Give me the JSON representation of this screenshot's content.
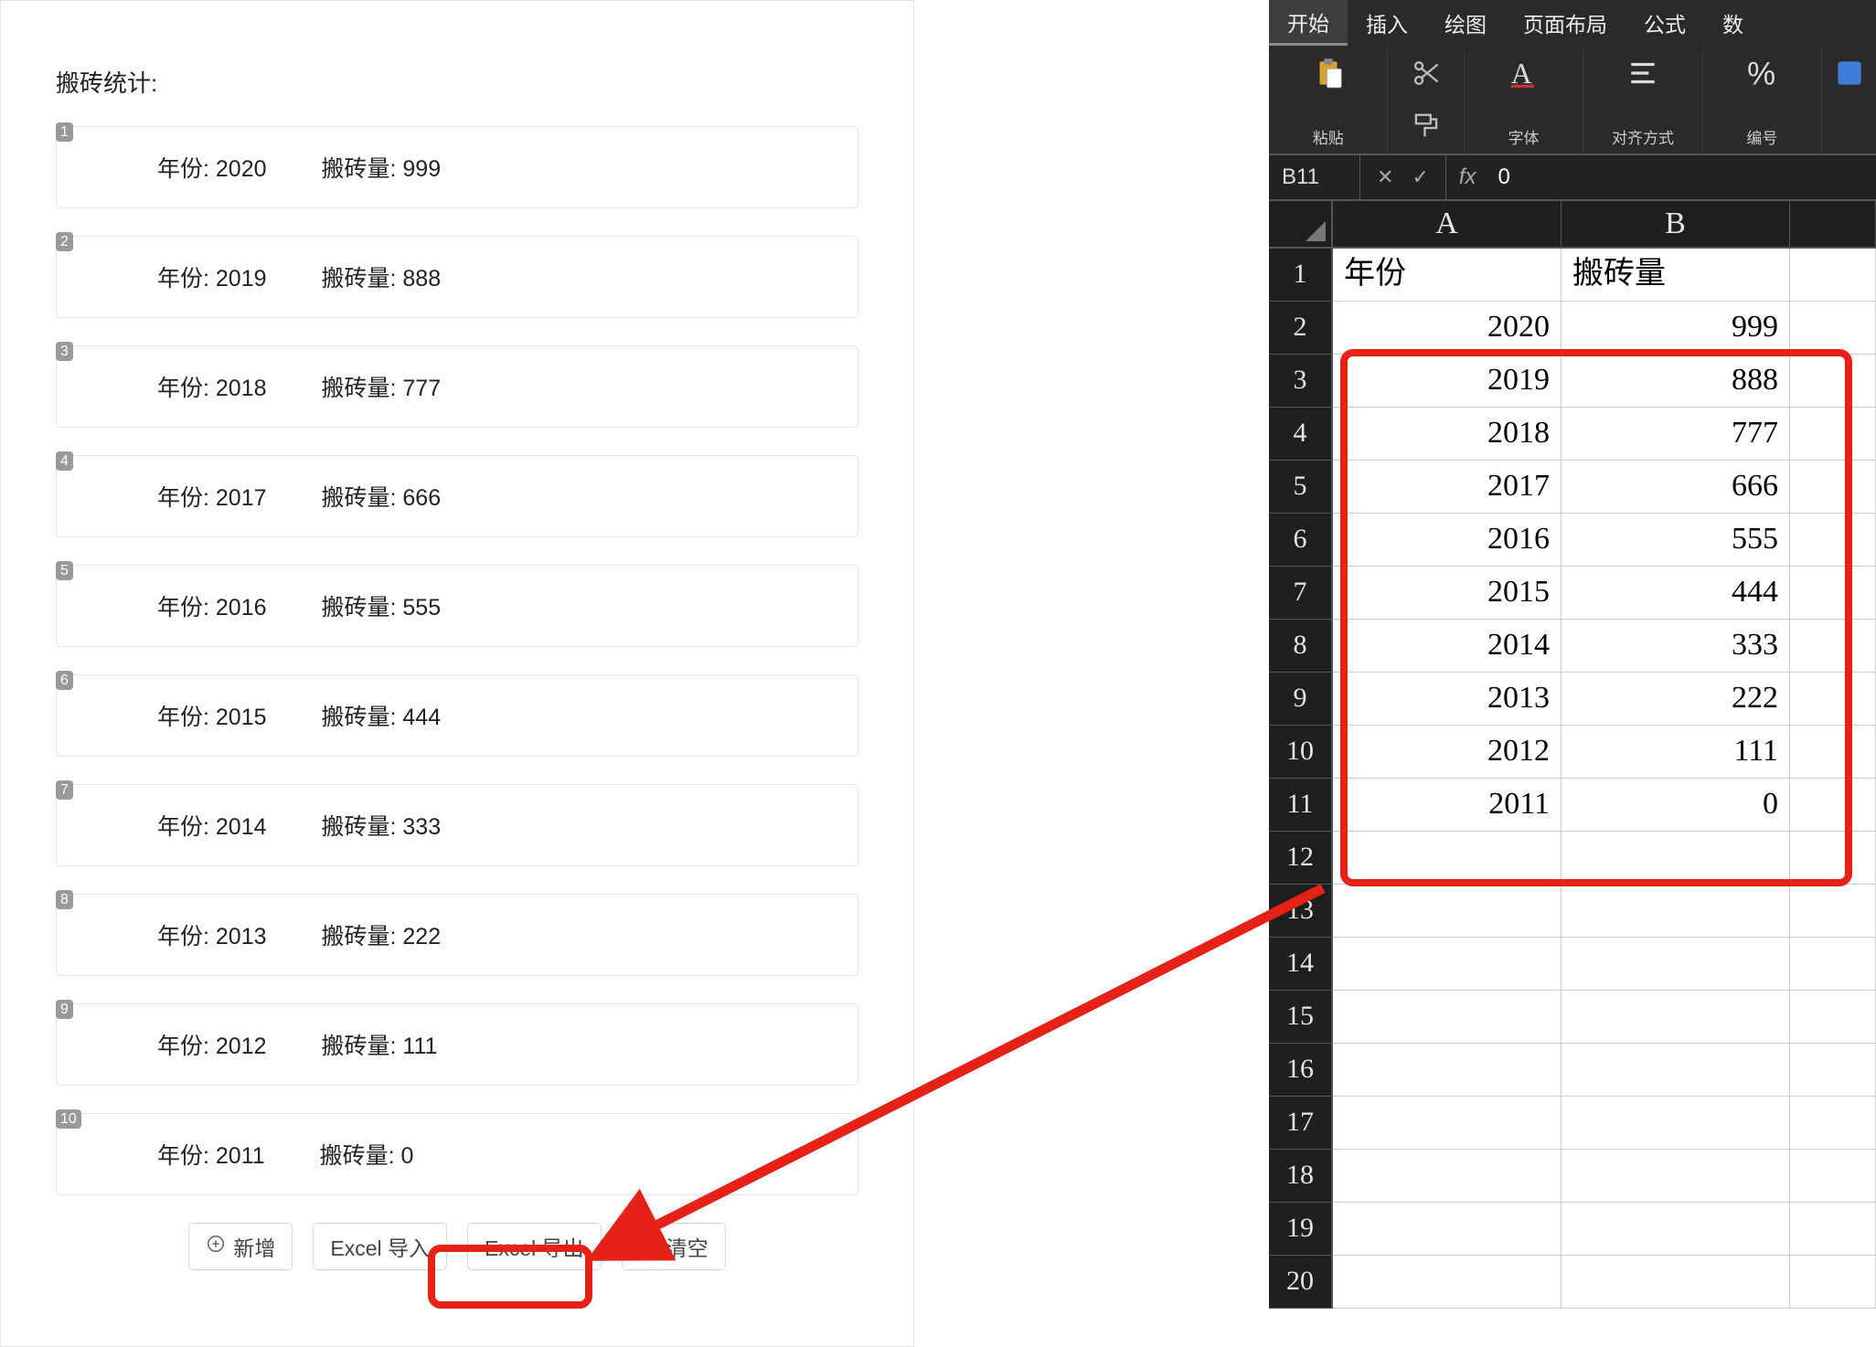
{
  "left": {
    "title": "搬砖统计:",
    "year_label": "年份",
    "amount_label": "搬砖量",
    "rows": [
      {
        "idx": "1",
        "year": "2020",
        "amount": "999"
      },
      {
        "idx": "2",
        "year": "2019",
        "amount": "888"
      },
      {
        "idx": "3",
        "year": "2018",
        "amount": "777"
      },
      {
        "idx": "4",
        "year": "2017",
        "amount": "666"
      },
      {
        "idx": "5",
        "year": "2016",
        "amount": "555"
      },
      {
        "idx": "6",
        "year": "2015",
        "amount": "444"
      },
      {
        "idx": "7",
        "year": "2014",
        "amount": "333"
      },
      {
        "idx": "8",
        "year": "2013",
        "amount": "222"
      },
      {
        "idx": "9",
        "year": "2012",
        "amount": "111"
      },
      {
        "idx": "10",
        "year": "2011",
        "amount": "0"
      }
    ],
    "buttons": {
      "add": "新增",
      "import": "Excel 导入",
      "export": "Excel 导出",
      "clear": "清空"
    }
  },
  "excel": {
    "tabs": [
      "开始",
      "插入",
      "绘图",
      "页面布局",
      "公式"
    ],
    "tabs_extra": "数",
    "active_tab": 0,
    "groups": [
      "粘贴",
      "字体",
      "对齐方式",
      "编号"
    ],
    "name_box": "B11",
    "formula_value": "0",
    "columns": [
      "A",
      "B"
    ],
    "row_count": 20,
    "header_row": {
      "A": "年份",
      "B": "搬砖量"
    },
    "data": [
      {
        "A": "2020",
        "B": "999"
      },
      {
        "A": "2019",
        "B": "888"
      },
      {
        "A": "2018",
        "B": "777"
      },
      {
        "A": "2017",
        "B": "666"
      },
      {
        "A": "2016",
        "B": "555"
      },
      {
        "A": "2015",
        "B": "444"
      },
      {
        "A": "2014",
        "B": "333"
      },
      {
        "A": "2013",
        "B": "222"
      },
      {
        "A": "2012",
        "B": "111"
      },
      {
        "A": "2011",
        "B": "0"
      }
    ]
  }
}
